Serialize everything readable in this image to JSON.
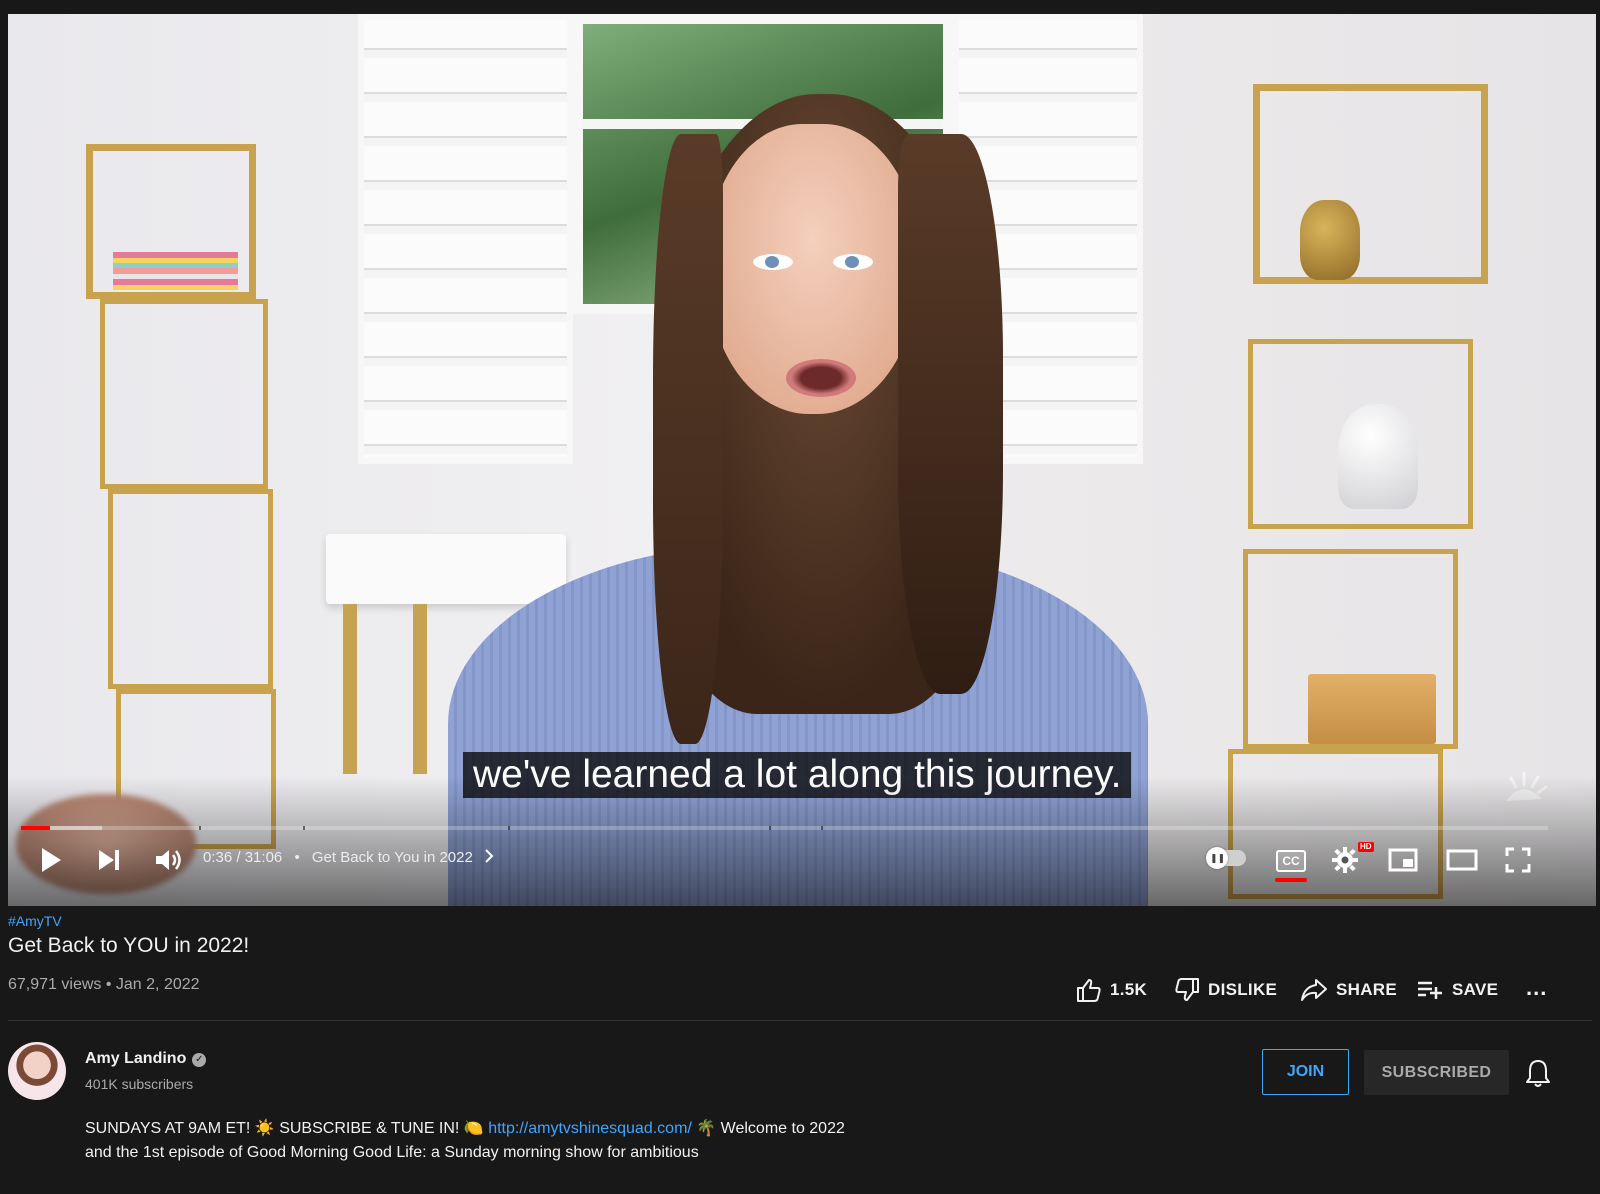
{
  "player": {
    "caption": "we've learned a lot along this journey.",
    "current_time": "0:36",
    "time_separator": "/",
    "duration": "31:06",
    "chapter_separator": "•",
    "chapter_title": "Get Back to You in 2022",
    "progress_played": 0.019,
    "progress_buffered": 0.053,
    "autoplay_on": false,
    "captions_on": true,
    "quality_badge": "HD",
    "cc_label": "CC",
    "icons": {
      "play": "play-icon",
      "next": "next-icon",
      "volume": "volume-icon",
      "chapter_chevron": "chevron-right-icon",
      "settings": "gear-icon",
      "miniplayer": "miniplayer-icon",
      "theater": "theater-mode-icon",
      "fullscreen": "fullscreen-icon",
      "watermark": "sun-watermark-icon"
    }
  },
  "video": {
    "hashtag": "#AmyTV",
    "title": "Get Back to YOU in 2022!",
    "views": "67,971 views",
    "meta_separator": "•",
    "date": "Jan 2, 2022"
  },
  "actions": {
    "like_count": "1.5K",
    "dislike_label": "DISLIKE",
    "share_label": "SHARE",
    "save_label": "SAVE",
    "more_label": "..."
  },
  "channel": {
    "name": "Amy Landino",
    "verified_mark": "✓",
    "subscribers": "401K subscribers",
    "join_label": "JOIN",
    "subscribed_label": "SUBSCRIBED"
  },
  "description": {
    "part1": "SUNDAYS AT 9AM ET! ☀️ SUBSCRIBE & TUNE IN! 🍋 ",
    "link": "http://amytvshinesquad.com/",
    "part2": " 🌴 Welcome to 2022 and the 1st episode of Good Morning Good Life: a Sunday morning show for ambitious"
  },
  "colors": {
    "background": "#181818",
    "accent_blue": "#3ea6ff",
    "progress_red": "#ff0000",
    "text_primary": "#f1f1f1",
    "text_secondary": "#aaaaaa"
  }
}
